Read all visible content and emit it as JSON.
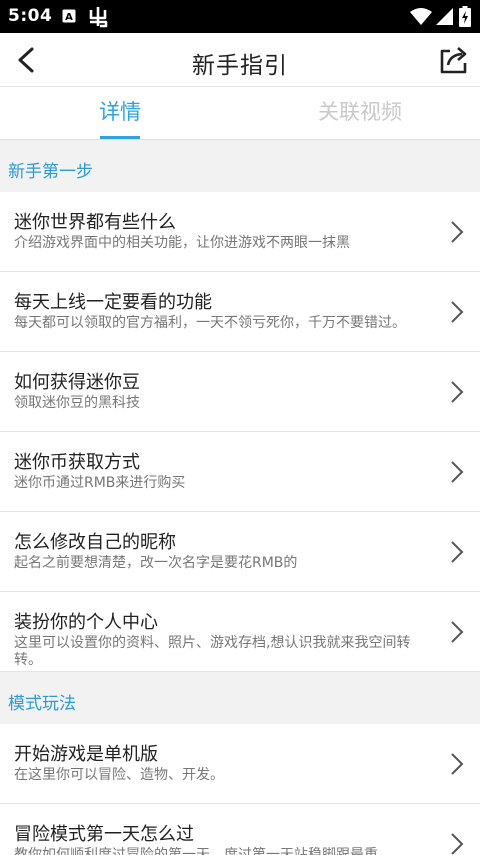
{
  "status_bar": {
    "time": "5:04",
    "icons": [
      "sim-card-icon",
      "bug-icon",
      "wifi-icon",
      "signal-icon",
      "battery-charging-icon"
    ]
  },
  "app_bar": {
    "title": "新手指引",
    "back_icon": "back-arrow-icon",
    "share_icon": "share-icon"
  },
  "tabs": [
    {
      "label": "详情",
      "active": true
    },
    {
      "label": "关联视频",
      "active": false
    }
  ],
  "sections": [
    {
      "header": "新手第一步",
      "items": [
        {
          "title": "迷你世界都有些什么",
          "subtitle": "介绍游戏界面中的相关功能，让你进游戏不两眼一抹黑"
        },
        {
          "title": "每天上线一定要看的功能",
          "subtitle": "每天都可以领取的官方福利，一天不领亏死你，千万不要错过。"
        },
        {
          "title": "如何获得迷你豆",
          "subtitle": "领取迷你豆的黑科技"
        },
        {
          "title": "迷你币获取方式",
          "subtitle": "迷你币通过RMB来进行购买"
        },
        {
          "title": "怎么修改自己的昵称",
          "subtitle": "起名之前要想清楚，改一次名字是要花RMB的"
        },
        {
          "title": "装扮你的个人中心",
          "subtitle": "这里可以设置你的资料、照片、游戏存档,想认识我就来我空间转转。"
        }
      ]
    },
    {
      "header": "模式玩法",
      "items": [
        {
          "title": "开始游戏是单机版",
          "subtitle": "在这里你可以冒险、造物、开发。"
        },
        {
          "title": "冒险模式第一天怎么过",
          "subtitle": "教你如何顺利度过冒险的第一天，度过第一天站稳脚跟最重"
        }
      ]
    }
  ],
  "colors": {
    "accent": "#2ea3de",
    "section_header": "#2a9bd6",
    "background": "#f2f2f2",
    "status_bar": "#000000"
  }
}
